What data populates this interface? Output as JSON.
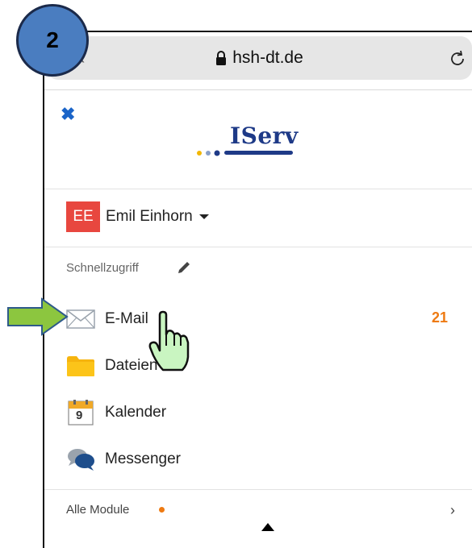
{
  "step": {
    "number": "2"
  },
  "browser": {
    "url": "hsh-dt.de",
    "back_label": "‹"
  },
  "app": {
    "logo_text": "IServ"
  },
  "user": {
    "initials": "EE",
    "name": "Emil Einhorn"
  },
  "quick_access": {
    "label": "Schnellzugriff"
  },
  "menu": {
    "items": [
      {
        "label": "E-Mail",
        "icon": "mail-icon",
        "badge": "21"
      },
      {
        "label": "Dateien",
        "icon": "folder-icon"
      },
      {
        "label": "Kalender",
        "icon": "calendar-icon",
        "day": "9"
      },
      {
        "label": "Messenger",
        "icon": "messenger-icon"
      }
    ]
  },
  "footer": {
    "all_modules_label": "Alle Module",
    "chevron": "›"
  },
  "colors": {
    "accent": "#1e3a87",
    "badge": "#ee7a12",
    "avatar": "#e8473f",
    "arrow": "#8cc63f"
  }
}
